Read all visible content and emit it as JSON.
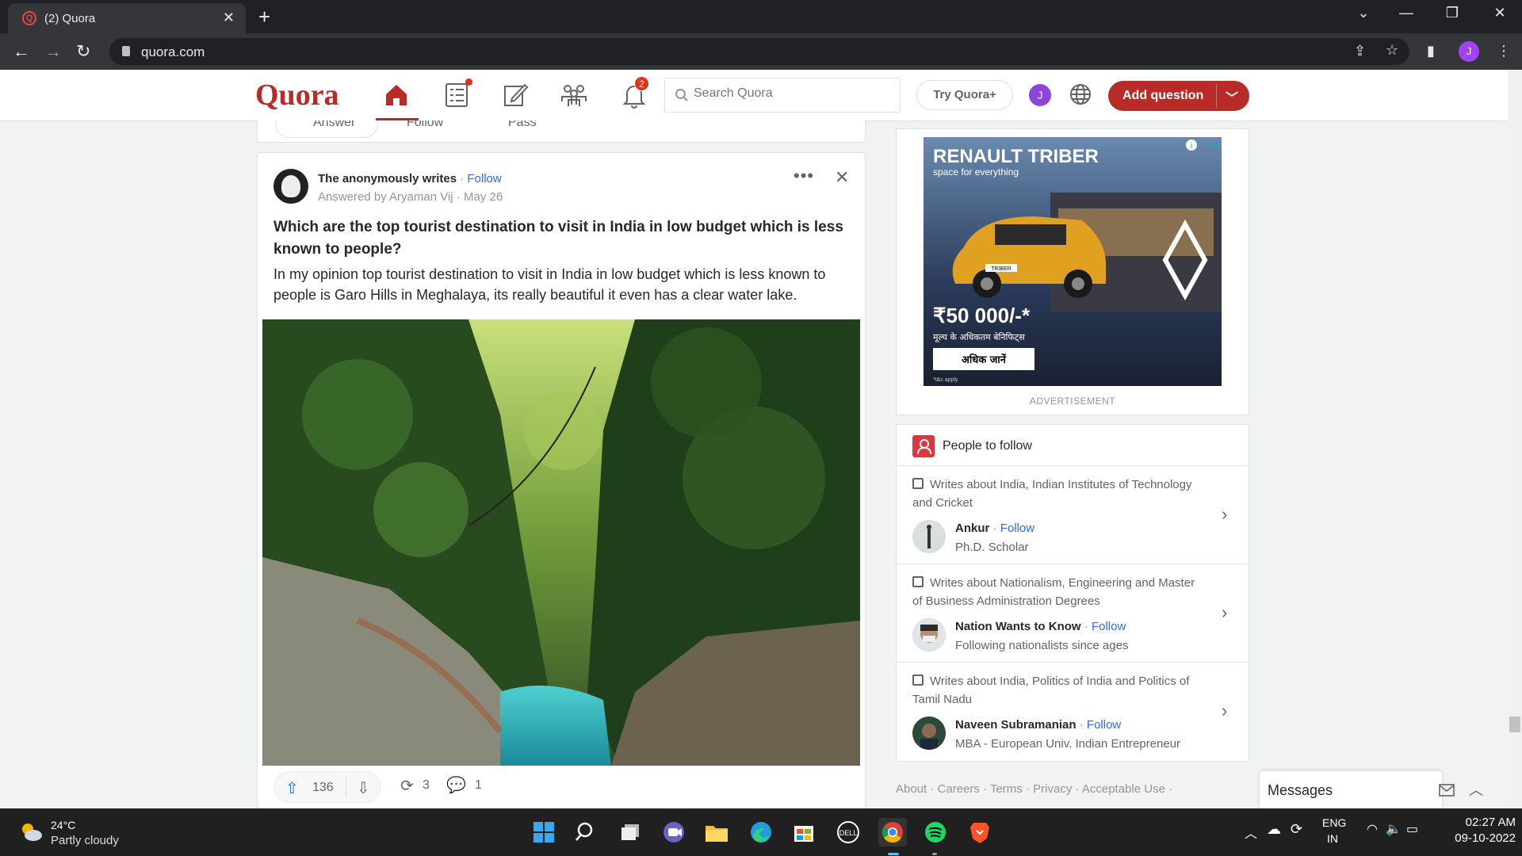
{
  "browser": {
    "tab_title": "(2) Quora",
    "url": "quora.com",
    "profile_initial": "J"
  },
  "header": {
    "logo": "Quora",
    "notification_count": "2",
    "search_placeholder": "Search Quora",
    "try_plus": "Try Quora+",
    "user_initial": "J",
    "add_question": "Add question"
  },
  "prev_card": {
    "answer": "Answer",
    "follow": "Follow",
    "pass": "Pass"
  },
  "post": {
    "author": "The anonymously writes",
    "follow": "Follow",
    "answered_by": "Answered by Aryaman Vij",
    "date": "May 26",
    "question": "Which are the top tourist destination to visit in India in low budget which is less known to people?",
    "text": "In my opinion top tourist destination to visit in India in low budget which is less known to people is Garo Hills in Meghalaya, its really beautiful it even has a clear water lake.",
    "upvotes": "136",
    "shares": "3",
    "comments": "1"
  },
  "ad": {
    "brand": "RENAULT TRIBER",
    "tagline": "space for everything",
    "badge": "TRIBER",
    "price": "₹50 000/-*",
    "benefit_text": "मूल्य के अधिकतम बेनिफिट्स",
    "cta": "अधिक जानें",
    "tc": "*t&c apply",
    "label": "ADVERTISEMENT"
  },
  "people_to_follow": {
    "title": "People to follow",
    "items": [
      {
        "why": "Writes about India, Indian Institutes of Technology and Cricket",
        "name": "Ankur",
        "follow": "Follow",
        "cred": "Ph.D. Scholar"
      },
      {
        "why": "Writes about Nationalism, Engineering and Master of Business Administration Degrees",
        "name": "Nation Wants to Know",
        "follow": "Follow",
        "cred": "Following nationalists since ages"
      },
      {
        "why": "Writes about India, Politics of India and Politics of Tamil Nadu",
        "name": "Naveen Subramanian",
        "follow": "Follow",
        "cred": "MBA - European Univ. Indian Entrepreneur"
      }
    ]
  },
  "footer": {
    "links": [
      "About",
      "Careers",
      "Terms",
      "Privacy",
      "Acceptable Use"
    ]
  },
  "messages": {
    "label": "Messages"
  },
  "taskbar": {
    "temp": "24°C",
    "condition": "Partly cloudy",
    "lang_top": "ENG",
    "lang_bottom": "IN",
    "time": "02:27 AM",
    "date": "09-10-2022"
  },
  "colors": {
    "brand": "#b92b27",
    "link": "#2e69ff"
  }
}
